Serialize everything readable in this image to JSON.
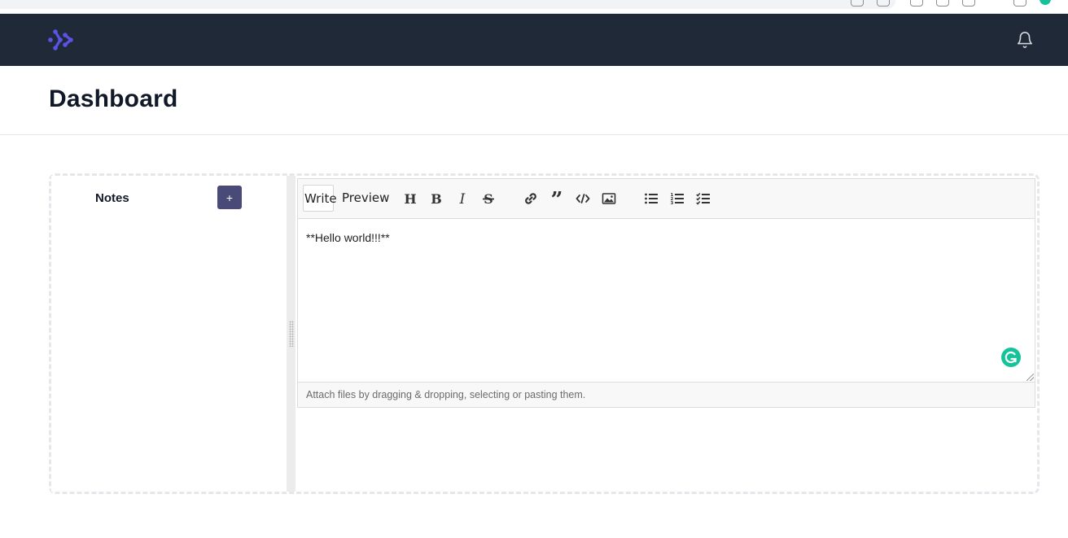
{
  "app": {
    "page_title": "Dashboard",
    "brand_color": "#4f46e5",
    "navbar_color": "#1f2937"
  },
  "notes": {
    "title": "Notes",
    "add_button_label": "+"
  },
  "editor": {
    "tabs": [
      {
        "label": "Write",
        "active": true
      },
      {
        "label": "Preview",
        "active": false
      }
    ],
    "toolbar_icons": [
      "heading-icon",
      "bold-icon",
      "italic-icon",
      "strikethrough-icon",
      "link-icon",
      "quote-icon",
      "code-icon",
      "image-icon",
      "unordered-list-icon",
      "ordered-list-icon",
      "checklist-icon"
    ],
    "content": "**Hello world!!!**",
    "attach_hint": "Attach files by dragging & dropping, selecting or pasting them."
  }
}
